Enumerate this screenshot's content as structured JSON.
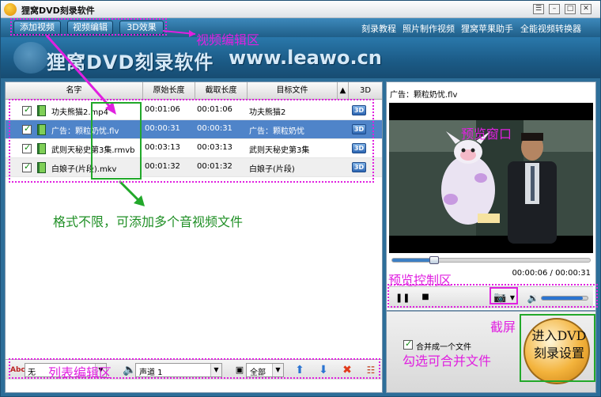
{
  "window": {
    "title": "狸窝DVD刻录软件"
  },
  "nav": {
    "buttons": [
      "添加视频",
      "视频编辑",
      "3D效果"
    ],
    "links": [
      "刻录教程",
      "照片制作视频",
      "狸窝苹果助手",
      "全能视频转换器"
    ]
  },
  "banner": {
    "title": "狸窝DVD刻录软件",
    "url": "www.leawo.cn"
  },
  "table": {
    "columns": [
      "名字",
      "原始长度",
      "截取长度",
      "目标文件",
      "3D"
    ],
    "rows": [
      {
        "name": "功夫熊猫2.mp4",
        "original": "00:01:06",
        "trimmed": "00:01:06",
        "target": "功夫熊猫2",
        "badge": "3D"
      },
      {
        "name": "广告：颗粒奶忧.flv",
        "original": "00:00:31",
        "trimmed": "00:00:31",
        "target": "广告：颗粒奶忧",
        "badge": "3D"
      },
      {
        "name": "武则天秘史第3集.rmvb",
        "original": "00:03:13",
        "trimmed": "00:03:13",
        "target": "武则天秘史第3集",
        "badge": "3D"
      },
      {
        "name": "白娘子(片段).mkv",
        "original": "00:01:32",
        "trimmed": "00:01:32",
        "target": "白娘子(片段)",
        "badge": "3D"
      }
    ]
  },
  "list_toolbar": {
    "subtitle_value": "无",
    "audio_value": "声道 1",
    "range_value": "全部"
  },
  "preview": {
    "title": "广告：颗粒奶忧.flv",
    "time_readout": "00:00:06 / 00:00:31",
    "progress": 0.21,
    "volume": 0.9
  },
  "merge": {
    "label": "合并成一个文件"
  },
  "dvd_button": {
    "line1": "进入DVD",
    "line2": "刻录设置"
  },
  "annotations": {
    "video_edit_area": "视频编辑区",
    "formats_note": "格式不限，可添加多个音视频文件",
    "preview_window": "预览窗口",
    "preview_controls": "预览控制区",
    "screenshot": "截屏",
    "list_edit_area": "列表编辑区",
    "merge_note": "勾选可合并文件"
  },
  "colors": {
    "accent": "#2d6e99",
    "selected_row": "#4f84c9",
    "annotation": "#e020e0",
    "annotation_green": "#22a82a"
  }
}
